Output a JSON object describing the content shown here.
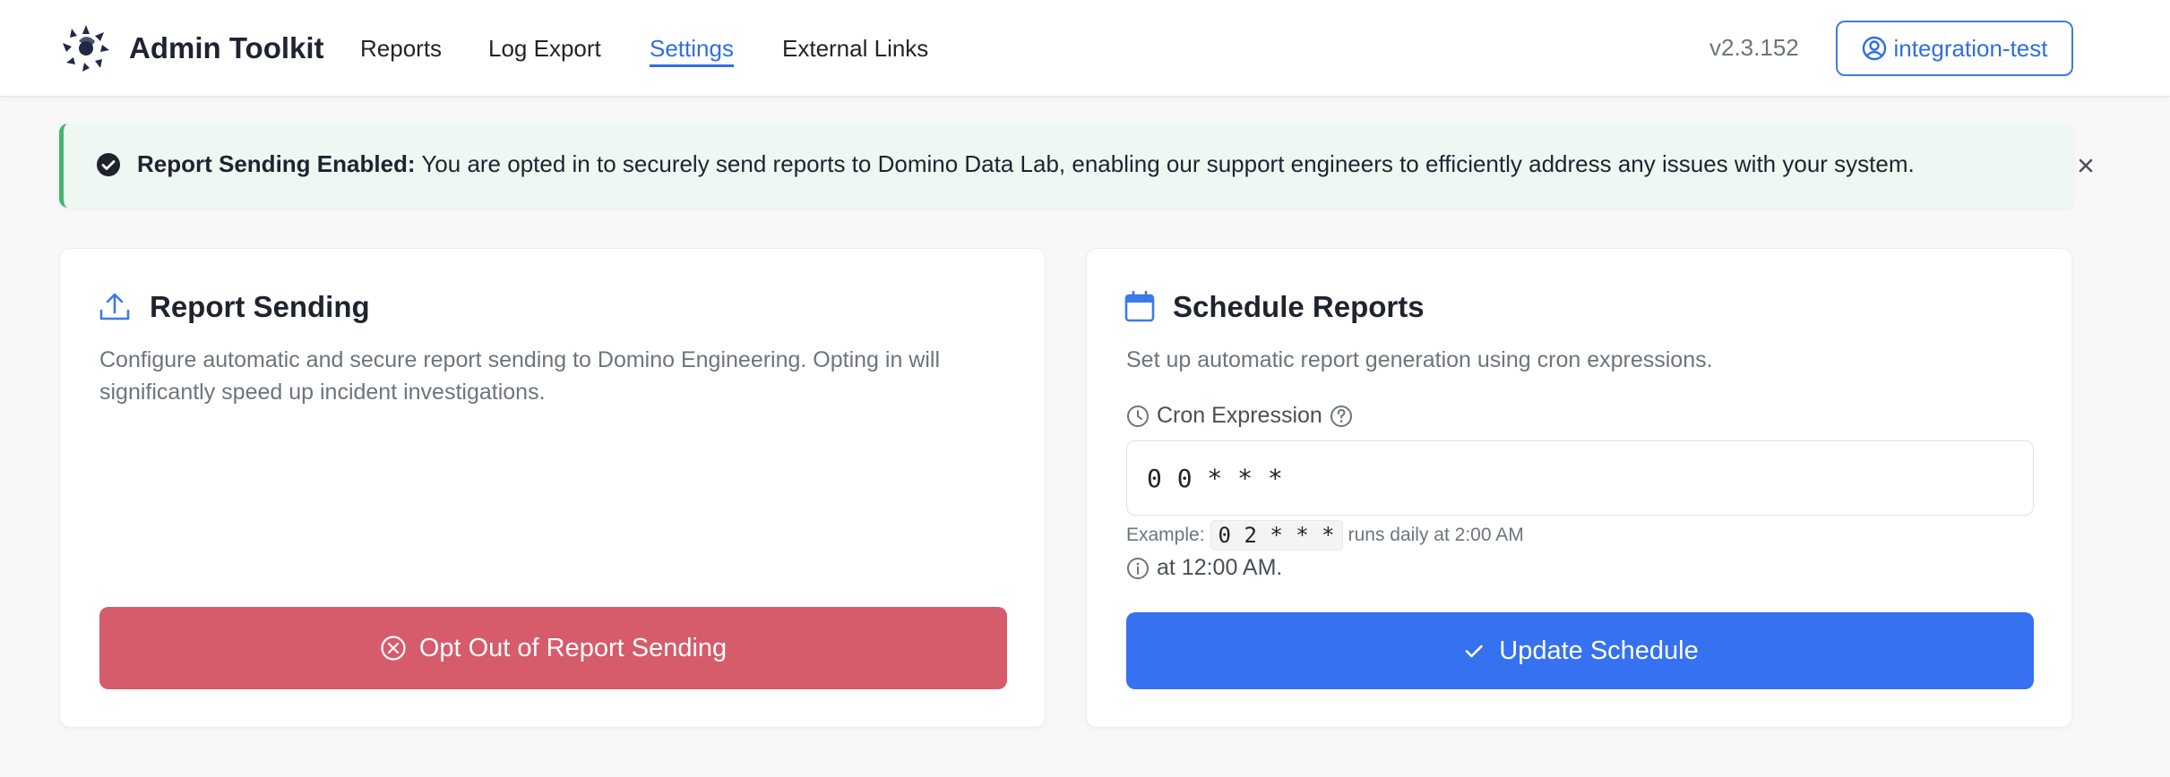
{
  "header": {
    "app_title": "Admin Toolkit",
    "logo_icon": "domino-logo-icon",
    "nav": [
      {
        "label": "Reports"
      },
      {
        "label": "Log Export"
      },
      {
        "label": "Settings",
        "active": true
      },
      {
        "label": "External Links"
      }
    ],
    "version": "v2.3.152",
    "user": "integration-test"
  },
  "alert": {
    "title": "Report Sending Enabled:",
    "message": "You are opted in to securely send reports to Domino Data Lab, enabling our support engineers to efficiently address any issues with your system.",
    "icon": "check-circle-icon",
    "close_icon": "close-icon",
    "color": "#47b46d"
  },
  "report_sending": {
    "title": "Report Sending",
    "icon": "upload-icon",
    "description": "Configure automatic and secure report sending to Domino Engineering. Opting in will significantly speed up incident investigations.",
    "button_label": "Opt Out of Report Sending",
    "button_color": "#d65b6b"
  },
  "schedule": {
    "title": "Schedule Reports",
    "icon": "calendar-icon",
    "description": "Set up automatic report generation using cron expressions.",
    "field_label": "Cron Expression",
    "cron_value": "0 0 * * *",
    "example_prefix": "Example:",
    "example_code": "0 2 * * *",
    "example_suffix": "runs daily at 2:00 AM",
    "next_run": "at 12:00 AM.",
    "button_label": "Update Schedule",
    "button_color": "#3571f0"
  }
}
